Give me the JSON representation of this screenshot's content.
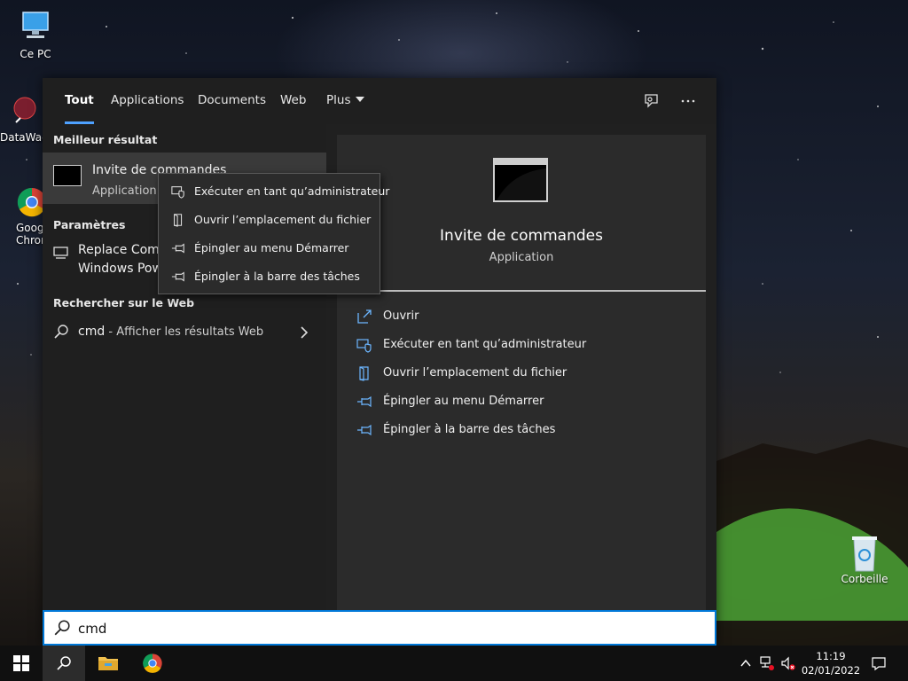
{
  "desktop": {
    "icons": [
      {
        "label": "Ce PC"
      },
      {
        "label": "DataWag"
      },
      {
        "label": "Goog"
      },
      {
        "label": "Chron"
      },
      {
        "label": "Corbeille"
      }
    ]
  },
  "search": {
    "tabs": [
      "Tout",
      "Applications",
      "Documents",
      "Web",
      "Plus"
    ],
    "active_tab": "Tout",
    "query": "cmd",
    "sections": {
      "best": "Meilleur résultat",
      "settings": "Paramètres",
      "web": "Rechercher sur le Web"
    },
    "best_result": {
      "title": "Invite de commandes",
      "subtitle": "Application"
    },
    "settings_item": {
      "line1": "Replace Comm",
      "line2": "Windows Pow"
    },
    "web_item": {
      "query": "cmd",
      "suffix": " - Afficher les résultats Web"
    },
    "preview": {
      "title": "Invite de commandes",
      "subtitle": "Application",
      "actions": [
        "Ouvrir",
        "Exécuter en tant qu’administrateur",
        "Ouvrir l’emplacement du fichier",
        "Épingler au menu Démarrer",
        "Épingler à la barre des tâches"
      ]
    },
    "context_menu": [
      "Exécuter en tant qu’administrateur",
      "Ouvrir l’emplacement du fichier",
      "Épingler au menu Démarrer",
      "Épingler à la barre des tâches"
    ]
  },
  "taskbar": {
    "time": "11:19",
    "date": "02/01/2022"
  },
  "colors": {
    "accent": "#0078d7",
    "tab_underline": "#4ea1ff",
    "panel": "#202020"
  }
}
